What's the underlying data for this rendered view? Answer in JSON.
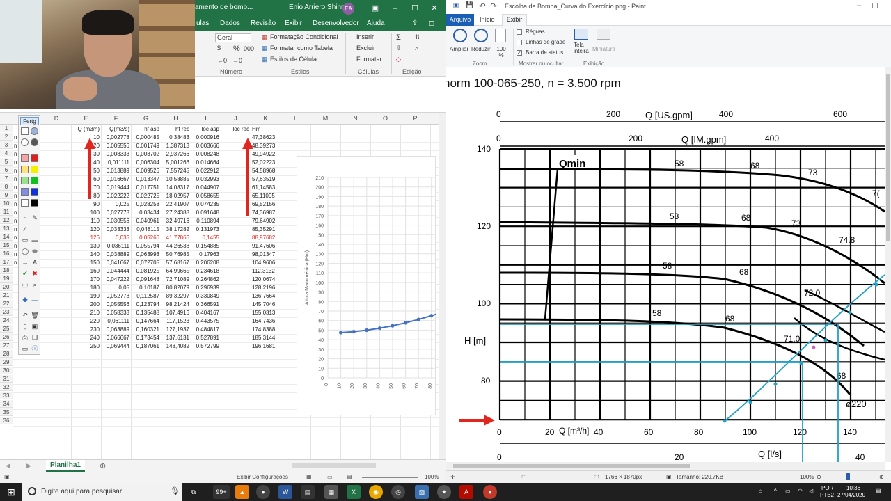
{
  "excel": {
    "title_suffix": "amento de bomb...",
    "user_name": "Enio Arriero Shinma",
    "user_initials": "EA",
    "tabs": [
      "ulas",
      "Dados",
      "Revisão",
      "Exibir",
      "Desenvolvedor",
      "Ajuda"
    ],
    "ribbon": {
      "number_format": "Geral",
      "percent": "%",
      "thousands": "000",
      "cond_format": "Formatação Condicional",
      "format_table": "Formatar como Tabela",
      "cell_styles": "Estilos de Célula",
      "insert": "Inserir",
      "delete": "Excluir",
      "format": "Formatar",
      "group_number": "Número",
      "group_styles": "Estilos",
      "group_cells": "Células",
      "group_edit": "Edição"
    },
    "columns": [
      "D",
      "E",
      "F",
      "G",
      "H",
      "I",
      "J",
      "K",
      "L",
      "M",
      "N",
      "O",
      "P"
    ],
    "header_row": [
      "Q (m3/h)",
      "Q(m3/s)",
      "hf asp",
      "hf rec",
      "loc asp",
      "loc rec",
      "Hm"
    ],
    "rows": [
      [
        "10",
        "0,002778",
        "0,000485",
        "0,38483",
        "0,000916",
        "47,38623"
      ],
      [
        "20",
        "0,005556",
        "0,001749",
        "1,387313",
        "0,003666",
        "48,39273"
      ],
      [
        "30",
        "0,008333",
        "0,003702",
        "2,937266",
        "0,008248",
        "49,94922"
      ],
      [
        "40",
        "0,011111",
        "0,006304",
        "5,001266",
        "0,014664",
        "52,02223"
      ],
      [
        "50",
        "0,013889",
        "0,009526",
        "7,557245",
        "0,022912",
        "54,58968"
      ],
      [
        "60",
        "0,016667",
        "0,013347",
        "10,58885",
        "0,032993",
        "57,63519"
      ],
      [
        "70",
        "0,019444",
        "0,017751",
        "14,08317",
        "0,044907",
        "61,14583"
      ],
      [
        "80",
        "0,022222",
        "0,022725",
        "18,02957",
        "0,058655",
        "65,11095"
      ],
      [
        "90",
        "0,025",
        "0,028258",
        "22,41907",
        "0,074235",
        "69,52156"
      ],
      [
        "100",
        "0,027778",
        "0,03434",
        "27,24388",
        "0,091648",
        "74,36987"
      ],
      [
        "110",
        "0,030556",
        "0,040961",
        "32,49716",
        "0,110894",
        "79,64902"
      ],
      [
        "120",
        "0,033333",
        "0,048115",
        "38,17282",
        "0,131973",
        "85,35291"
      ],
      [
        "126",
        "0,035",
        "0,05266",
        "41,77866",
        "0,1455",
        "88,97682"
      ],
      [
        "130",
        "0,036111",
        "0,055794",
        "44,26538",
        "0,154885",
        "91,47606"
      ],
      [
        "140",
        "0,038889",
        "0,063993",
        "50,76985",
        "0,17963",
        "98,01347"
      ],
      [
        "150",
        "0,041667",
        "0,072705",
        "57,68167",
        "0,206208",
        "104,9606"
      ],
      [
        "160",
        "0,044444",
        "0,081925",
        "64,99665",
        "0,234618",
        "112,3132"
      ],
      [
        "170",
        "0,047222",
        "0,091648",
        "72,71089",
        "0,264862",
        "120,0674"
      ],
      [
        "180",
        "0,05",
        "0,10187",
        "80,82079",
        "0,296939",
        "128,2196"
      ],
      [
        "190",
        "0,052778",
        "0,112587",
        "89,32297",
        "0,330849",
        "136,7664"
      ],
      [
        "200",
        "0,055556",
        "0,123794",
        "98,21424",
        "0,366591",
        "145,7046"
      ],
      [
        "210",
        "0,058333",
        "0,135488",
        "107,4916",
        "0,404167",
        "155,0313"
      ],
      [
        "220",
        "0,061111",
        "0,147664",
        "117,1523",
        "0,443575",
        "164,7436"
      ],
      [
        "230",
        "0,063889",
        "0,160321",
        "127,1937",
        "0,484817",
        "174,8388"
      ],
      [
        "240",
        "0,066667",
        "0,173454",
        "137,6131",
        "0,527891",
        "185,3144"
      ],
      [
        "250",
        "0,069444",
        "0,187061",
        "148,4082",
        "0,572799",
        "196,1681"
      ]
    ],
    "row_numbers": [
      "1",
      "2",
      "3",
      "4",
      "5",
      "6",
      "7",
      "8",
      "9",
      "10",
      "11",
      "12",
      "13",
      "14",
      "15",
      "16",
      "17",
      "18",
      "19",
      "20",
      "21",
      "22",
      "23",
      "24",
      "25",
      "26",
      "27",
      "28",
      "29",
      "30",
      "31",
      "32",
      "33",
      "34",
      "35",
      "36"
    ],
    "left_col_fragment": "n",
    "sheet_tab": "Planilha1",
    "status_display": "Exibir Configurações",
    "zoom": "100%",
    "tool_palette_title": "Fertg"
  },
  "excel_chart": {
    "ylabel": "Altura Manométrica (Hm)",
    "y_ticks": [
      "0",
      "10",
      "20",
      "30",
      "40",
      "50",
      "60",
      "70",
      "80",
      "90",
      "100",
      "110",
      "120",
      "130",
      "140",
      "150",
      "160",
      "170",
      "180",
      "190",
      "200",
      "210"
    ],
    "x_ticks": [
      "0",
      "10",
      "20",
      "30",
      "40",
      "50",
      "60",
      "70",
      "80",
      "90"
    ]
  },
  "chart_data": {
    "type": "scatter",
    "title": "",
    "xlabel": "",
    "ylabel": "Altura Manométrica (Hm)",
    "ylim": [
      0,
      210
    ],
    "xlim": [
      0,
      100
    ],
    "x": [
      10,
      20,
      30,
      40,
      50,
      60,
      70,
      80,
      90,
      100
    ],
    "y": [
      47.39,
      48.39,
      49.95,
      52.02,
      54.59,
      57.64,
      61.15,
      65.11,
      69.52,
      74.37
    ],
    "color": "#4472c4"
  },
  "paint": {
    "title": "Escolha de Bomba_Curva do Exercício.png - Paint",
    "tabs": {
      "file": "Arquivo",
      "home": "Início",
      "view": "Exibir"
    },
    "ribbon": {
      "zoom_in": "Ampliar",
      "zoom_out": "Reduzir",
      "zoom_100": "100 %",
      "rulers": "Réguas",
      "gridlines": "Linhas de grade",
      "statusbar": "Barra de status",
      "fullscreen": "Tela inteira",
      "thumbnail": "Miniatura",
      "group_zoom": "Zoom",
      "group_show": "Mostrar ou ocultar",
      "group_display": "Exibição"
    },
    "status": {
      "dimensions": "1766 × 1870px",
      "size": "Tamanho: 220,7KB",
      "zoom": "100%"
    }
  },
  "pump_curve": {
    "header": "norm 100-065-250, n = 3.500 rpm",
    "axis_usgpm": "Q [US.gpm]",
    "usgpm_ticks": [
      "0",
      "200",
      "400",
      "600"
    ],
    "axis_imgpm": "Q [IM.gpm]",
    "imgpm_ticks": [
      "0",
      "200",
      "400"
    ],
    "axis_h": "H [m]",
    "h_ticks": [
      "140",
      "120",
      "100",
      "80"
    ],
    "axis_q": "Q [m³/h]",
    "q_ticks": [
      "0",
      "20",
      "40",
      "60",
      "80",
      "100",
      "120",
      "140"
    ],
    "axis_ls": "Q [l/s]",
    "ls_ticks": [
      "0",
      "20",
      "40"
    ],
    "qmin": "Qmin",
    "efficiency_labels": [
      "58",
      "68",
      "73",
      "7(",
      "58",
      "68",
      "73",
      "74.8",
      "58",
      "68",
      "72.0",
      "58",
      "68",
      "71.0",
      "68"
    ],
    "impeller": "ø220"
  },
  "taskbar": {
    "search_placeholder": "Digite aqui para pesquisar",
    "lang": "POR",
    "lang2": "PTB2",
    "time": "10:36",
    "date": "27/04/2020",
    "badge": "99+"
  }
}
